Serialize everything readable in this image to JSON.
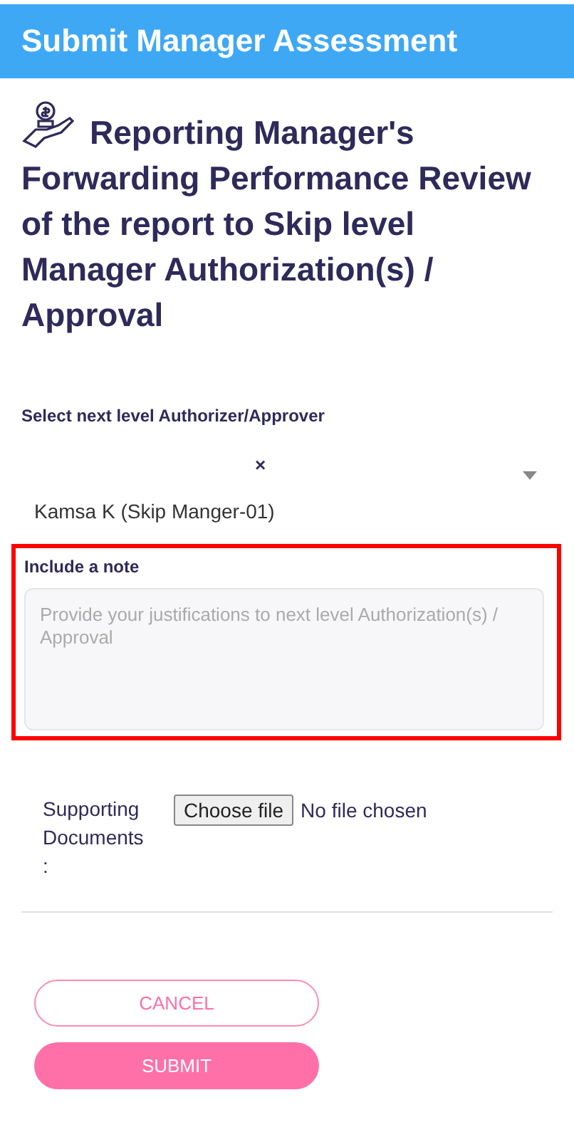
{
  "header": {
    "title": "Submit Manager Assessment"
  },
  "heading": "Reporting Manager's Forwarding Performance Review of the report to Skip level Manager Authorization(s) / Approval",
  "approver": {
    "label": "Select next level Authorizer/Approver",
    "clear": "×",
    "value": "Kamsa K (Skip Manger-01)"
  },
  "note": {
    "label": "Include a note",
    "placeholder": "Provide your justifications to next level Authorization(s) / Approval",
    "highlighted": true
  },
  "documents": {
    "label": "Supporting Documents\n:",
    "button": "Choose file",
    "status": "No file chosen"
  },
  "buttons": [
    {
      "kind": "outline",
      "label": "CANCEL"
    },
    {
      "kind": "filled",
      "label": "SUBMIT"
    }
  ]
}
